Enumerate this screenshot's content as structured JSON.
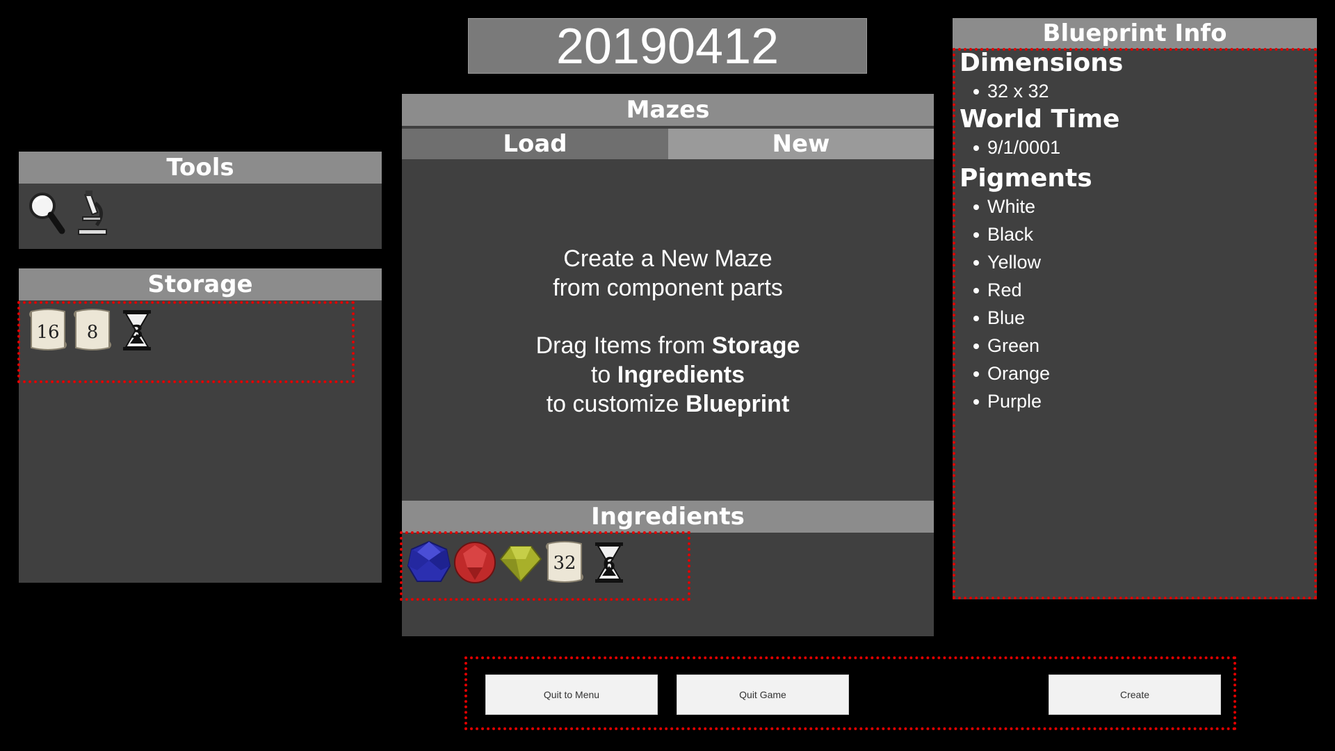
{
  "seed": "20190412",
  "tools": {
    "title": "Tools",
    "items": [
      {
        "icon": "magnifier-icon"
      },
      {
        "icon": "microscope-icon"
      }
    ]
  },
  "storage": {
    "title": "Storage",
    "items": [
      {
        "icon": "scroll-icon",
        "label": "16"
      },
      {
        "icon": "scroll-icon",
        "label": "8"
      },
      {
        "icon": "hourglass-icon",
        "label": "3"
      }
    ]
  },
  "mazes": {
    "title": "Mazes",
    "tabs": [
      {
        "label": "Load"
      },
      {
        "label": "New"
      }
    ],
    "description": {
      "line1": "Create a New Maze",
      "line2": "from component parts",
      "line3_pre": "Drag Items from ",
      "line3_bold": "Storage",
      "line4_pre": "to ",
      "line4_bold": "Ingredients",
      "line5_pre": "to customize ",
      "line5_bold": "Blueprint"
    }
  },
  "ingredients": {
    "title": "Ingredients",
    "items": [
      {
        "icon": "blue-gem-icon",
        "color": "#2b2fb0"
      },
      {
        "icon": "red-gem-icon",
        "color": "#c02a2a"
      },
      {
        "icon": "yellow-gem-icon",
        "color": "#a8b02a"
      },
      {
        "icon": "scroll-icon",
        "label": "32"
      },
      {
        "icon": "hourglass-icon",
        "label": "6"
      }
    ]
  },
  "blueprint": {
    "title": "Blueprint Info",
    "dimensions_title": "Dimensions",
    "dimensions": [
      "32 x 32"
    ],
    "world_time_title": "World Time",
    "world_time": [
      "9/1/0001"
    ],
    "pigments_title": "Pigments",
    "pigments": [
      "White",
      "Black",
      "Yellow",
      "Red",
      "Blue",
      "Green",
      "Orange",
      "Purple"
    ]
  },
  "buttons": {
    "quit_menu": "Quit to Menu",
    "quit_game": "Quit Game",
    "create": "Create"
  },
  "colors": {
    "panel": "#404040",
    "header": "#8c8c8c",
    "highlight": "#e00000"
  }
}
